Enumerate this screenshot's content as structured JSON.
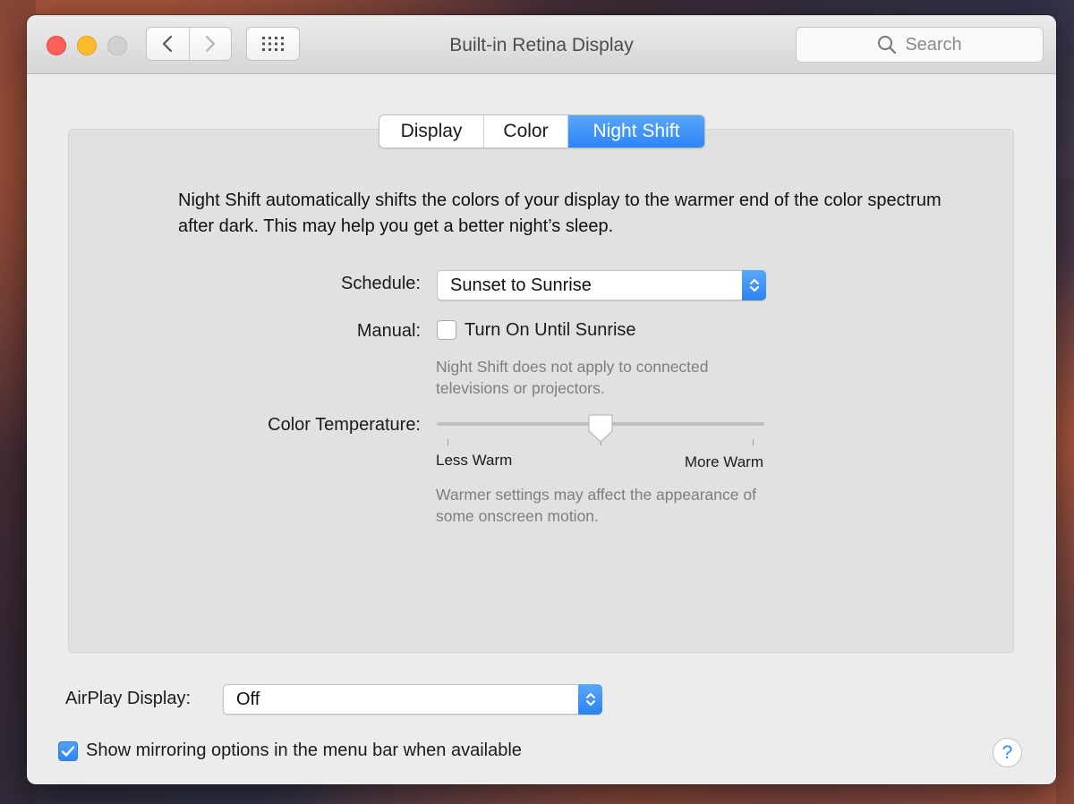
{
  "window": {
    "title": "Built-in Retina Display",
    "search_placeholder": "Search"
  },
  "tabs": [
    {
      "label": "Display",
      "selected": false
    },
    {
      "label": "Color",
      "selected": false
    },
    {
      "label": "Night Shift",
      "selected": true
    }
  ],
  "night_shift": {
    "description": "Night Shift automatically shifts the colors of your display to the warmer end of the color spectrum after dark. This may help you get a better night’s sleep.",
    "schedule_label": "Schedule:",
    "schedule_value": "Sunset to Sunrise",
    "manual_label": "Manual:",
    "manual_checkbox_label": "Turn On Until Sunrise",
    "manual_checked": false,
    "manual_note": "Night Shift does not apply to connected televisions or projectors.",
    "temperature_label": "Color Temperature:",
    "temperature_min_label": "Less Warm",
    "temperature_max_label": "More Warm",
    "temperature_value": 0.5,
    "temperature_note": "Warmer settings may affect the appearance of some onscreen motion."
  },
  "airplay": {
    "label": "AirPlay Display:",
    "value": "Off"
  },
  "mirroring": {
    "label": "Show mirroring options in the menu bar when available",
    "checked": true
  },
  "help_label": "?",
  "colors": {
    "accent": "#2d84f5",
    "close": "#fc5f57",
    "minimize": "#fdbc2e"
  }
}
